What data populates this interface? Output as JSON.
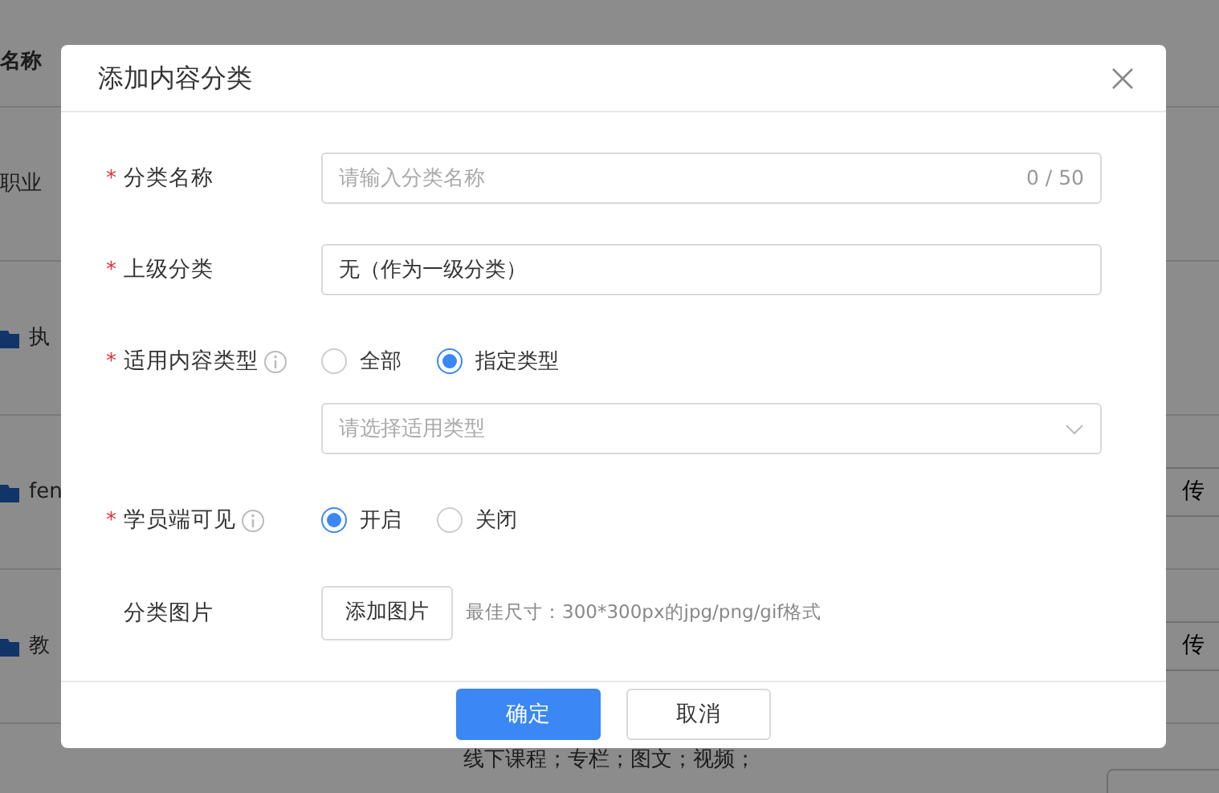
{
  "background": {
    "header": "名称",
    "rows": [
      {
        "kind": "plain",
        "text": "职业"
      },
      {
        "kind": "folder",
        "text": "执"
      },
      {
        "kind": "folder",
        "text": "fen",
        "button": "传"
      },
      {
        "kind": "folder",
        "text": "教",
        "button": "传"
      },
      {
        "kind": "types",
        "text": "线下课程；专栏；图文；视频；"
      }
    ]
  },
  "dialog": {
    "title": "添加内容分类",
    "fields": [
      {
        "kind": "text",
        "label": "分类名称",
        "required_mark": "*",
        "info": false,
        "placeholder": "请输入分类名称",
        "counter": "0 / 50"
      },
      {
        "kind": "value",
        "label": "上级分类",
        "required_mark": "*",
        "info": false,
        "value": "无（作为一级分类）"
      },
      {
        "kind": "radio",
        "label": "适用内容类型",
        "required_mark": "*",
        "info": true,
        "options": [
          {
            "label": "全部",
            "selected": false
          },
          {
            "label": "指定类型",
            "selected": true
          }
        ]
      },
      {
        "kind": "select",
        "placeholder": "请选择适用类型"
      },
      {
        "kind": "radio",
        "label": "学员端可见",
        "required_mark": "*",
        "info": true,
        "options": [
          {
            "label": "开启",
            "selected": true
          },
          {
            "label": "关闭",
            "selected": false
          }
        ]
      },
      {
        "kind": "upload",
        "label": "分类图片",
        "info": false,
        "button": "添加图片",
        "hint": "最佳尺寸：300*300px的jpg/png/gif格式"
      }
    ],
    "buttons": [
      {
        "label": "确定",
        "primary": true
      },
      {
        "label": "取消",
        "primary": false
      }
    ]
  }
}
